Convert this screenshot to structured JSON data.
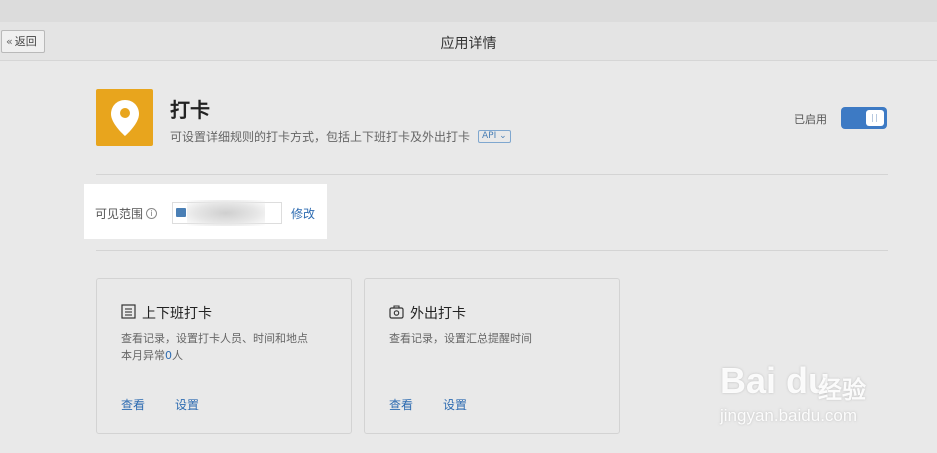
{
  "header": {
    "back_label": "返回",
    "title": "应用详情"
  },
  "app": {
    "name": "打卡",
    "description": "可设置详细规则的打卡方式，包括上下班打卡及外出打卡",
    "api_badge": "API ⌄",
    "icon": "location-pin-icon",
    "icon_color": "#e8a51d",
    "status_label": "已启用",
    "enabled": true,
    "toggle_color": "#3d7ac4"
  },
  "scope": {
    "label": "可见范围",
    "modify_label": "修改",
    "value_visible": false
  },
  "cards": [
    {
      "title": "上下班打卡",
      "icon": "list-icon",
      "description": "查看记录，设置打卡人员、时间和地点",
      "anomaly_prefix": "本月异常",
      "anomaly_count": "0",
      "anomaly_suffix": "人",
      "view_label": "查看",
      "settings_label": "设置"
    },
    {
      "title": "外出打卡",
      "icon": "camera-bag-icon",
      "description": "查看记录，设置汇总提醒时间",
      "view_label": "查看",
      "settings_label": "设置"
    }
  ],
  "watermark": {
    "brand": "Bai du",
    "product": "经验",
    "url": "jingyan.baidu.com"
  },
  "colors": {
    "link": "#2d6bb1",
    "background": "#e9e9e9"
  }
}
